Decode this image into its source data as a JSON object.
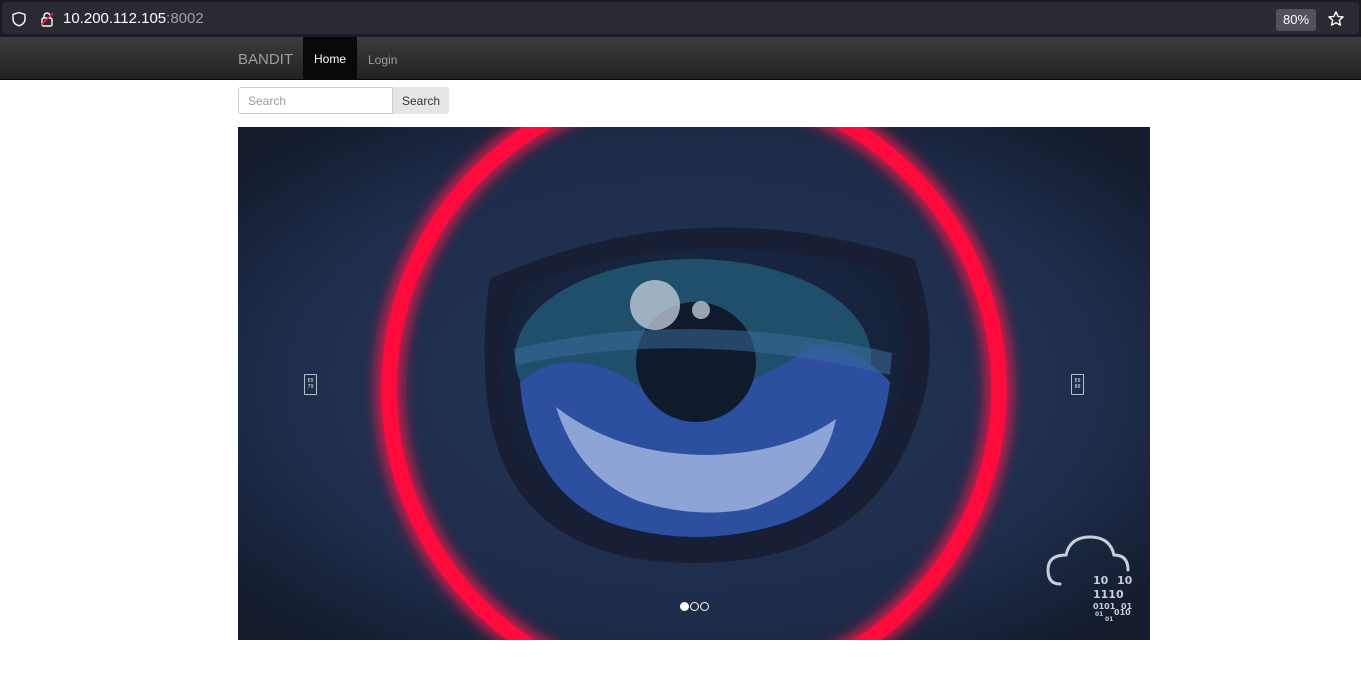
{
  "browser": {
    "url_host": "10.200.112.105",
    "url_port": ":8002",
    "zoom": "80%"
  },
  "navbar": {
    "brand": "BANDIT",
    "items": [
      {
        "label": "Home",
        "active": true
      },
      {
        "label": "Login",
        "active": false
      }
    ]
  },
  "search": {
    "placeholder": "Search",
    "button_label": "Search"
  },
  "carousel": {
    "slide_count": 3,
    "active_index": 0,
    "prev_glyph": "E0 79",
    "next_glyph": "E0 80",
    "logo_binary": [
      "10",
      "10",
      "1110",
      "0101",
      "01",
      "01",
      "010",
      "01"
    ]
  },
  "colors": {
    "navbar": "#222222",
    "ring": "#ff0a3c",
    "background_dark": "#1b2640",
    "iris": "#2b4d9c"
  }
}
